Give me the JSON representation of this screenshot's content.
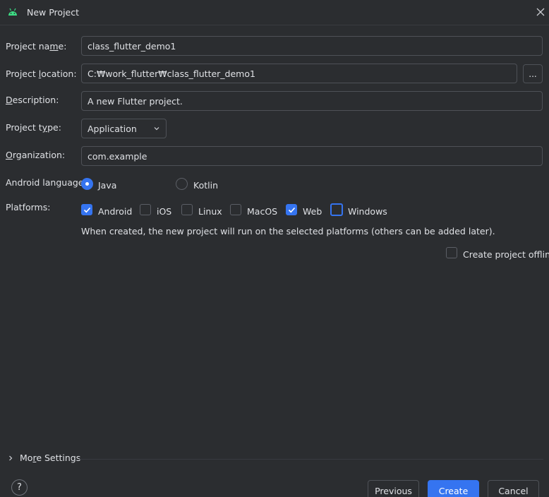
{
  "window": {
    "title": "New Project",
    "icon": "android-icon"
  },
  "form": {
    "project_name": {
      "label_pre": "Project na",
      "label_mn": "m",
      "label_post": "e:",
      "value": "class_flutter_demo1"
    },
    "project_location": {
      "label_pre": "Project ",
      "label_mn": "l",
      "label_post": "ocation:",
      "value": "C:₩work_flutter₩class_flutter_demo1",
      "browse_label": "..."
    },
    "description": {
      "label_pre": "",
      "label_mn": "D",
      "label_post": "escription:",
      "value": "A new Flutter project."
    },
    "project_type": {
      "label_pre": "Project t",
      "label_mn": "y",
      "label_post": "pe:",
      "value": "Application"
    },
    "organization": {
      "label_pre": "",
      "label_mn": "O",
      "label_post": "rganization:",
      "value": "com.example"
    },
    "android_language": {
      "label": "Android language:",
      "options": [
        {
          "label": "Java",
          "selected": true
        },
        {
          "label": "Kotlin",
          "selected": false
        }
      ]
    },
    "platforms": {
      "label": "Platforms:",
      "options": [
        {
          "label": "Android",
          "checked": true
        },
        {
          "label": "iOS",
          "checked": false
        },
        {
          "label": "Linux",
          "checked": false
        },
        {
          "label": "MacOS",
          "checked": false
        },
        {
          "label": "Web",
          "checked": true
        },
        {
          "label": "Windows",
          "checked": false
        }
      ],
      "hint": "When created, the new project will run on the selected platforms (others can be added later)."
    },
    "offline": {
      "label": "Create project offline",
      "checked": false
    }
  },
  "more_settings": {
    "label_pre": "Mo",
    "label_mn": "r",
    "label_post": "e Settings"
  },
  "footer": {
    "help_label": "?",
    "previous_label": "Previous",
    "create_label": "Create",
    "cancel_label": "Cancel"
  },
  "colors": {
    "accent": "#3574f0",
    "background": "#2b2d30",
    "border": "#4e5157",
    "android_green": "#3ddc84"
  }
}
